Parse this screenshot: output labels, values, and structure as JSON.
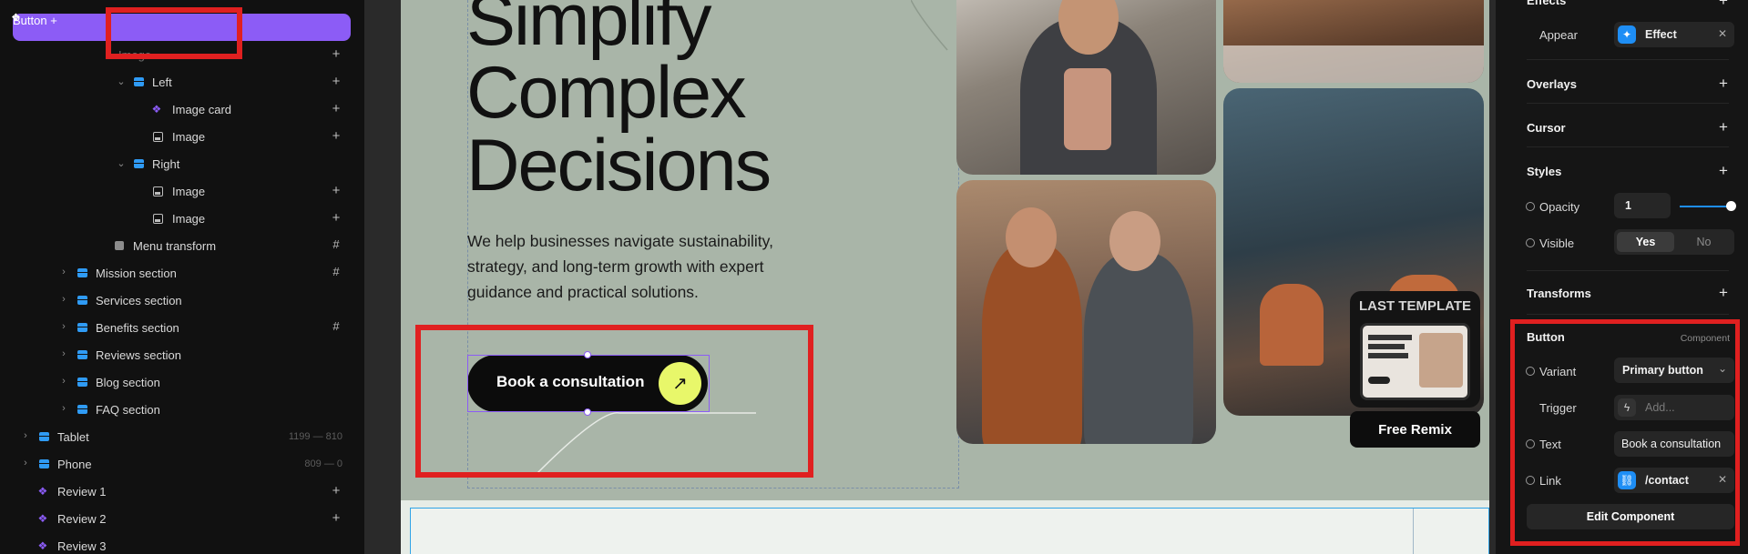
{
  "layers": {
    "selected": {
      "label": "Button"
    },
    "occluded": {
      "label": "Image"
    },
    "items": [
      {
        "label": "Left"
      },
      {
        "label": "Image card"
      },
      {
        "label": "Image"
      },
      {
        "label": "Right"
      },
      {
        "label": "Image"
      },
      {
        "label": "Image"
      },
      {
        "label": "Menu transform"
      },
      {
        "label": "Mission section"
      },
      {
        "label": "Services section"
      },
      {
        "label": "Benefits section"
      },
      {
        "label": "Reviews section"
      },
      {
        "label": "Blog section"
      },
      {
        "label": "FAQ section"
      },
      {
        "label": "Tablet",
        "dims": "1199 — 810"
      },
      {
        "label": "Phone",
        "dims": "809 — 0"
      },
      {
        "label": "Review 1"
      },
      {
        "label": "Review 2"
      },
      {
        "label": "Review 3"
      }
    ]
  },
  "canvas": {
    "headline": [
      "Simplify",
      "Complex",
      "Decisions"
    ],
    "subtext": "We help businesses navigate sustainability, strategy, and long-term growth with expert guidance and practical solutions.",
    "cta_label": "Book a consultation",
    "cta_arrow": "↗",
    "last_template_label": "LAST TEMPLATE",
    "free_remix_label": "Free Remix"
  },
  "properties": {
    "effects": {
      "title": "Effects",
      "appear_label": "Appear",
      "appear_value": "Effect"
    },
    "overlays": {
      "title": "Overlays"
    },
    "cursor": {
      "title": "Cursor"
    },
    "styles": {
      "title": "Styles",
      "opacity_label": "Opacity",
      "opacity_value": "1",
      "visible_label": "Visible",
      "visible_yes": "Yes",
      "visible_no": "No"
    },
    "transforms": {
      "title": "Transforms"
    },
    "component": {
      "title": "Button",
      "badge": "Component",
      "variant_label": "Variant",
      "variant_value": "Primary button",
      "trigger_label": "Trigger",
      "trigger_placeholder": "Add...",
      "text_label": "Text",
      "text_value": "Book a consultation",
      "link_label": "Link",
      "link_value": "/contact",
      "edit_button": "Edit Component"
    }
  },
  "colors": {
    "selection": "#8c5cf6",
    "frame_icon": "#2f9bf5",
    "highlight_red": "#e02020",
    "cta_accent": "#e8f76a",
    "hero_bg": "#a9b5a8"
  }
}
